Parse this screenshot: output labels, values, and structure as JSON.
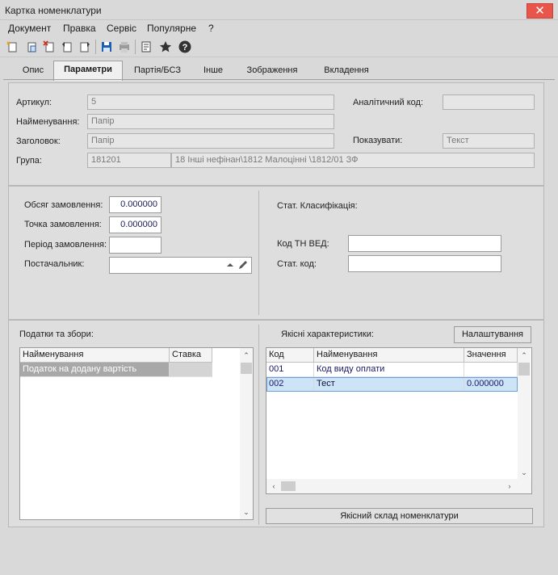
{
  "window": {
    "title": "Картка номенклатури",
    "close_glyph": "✕"
  },
  "menu": [
    "Документ",
    "Правка",
    "Сервіс",
    "Популярне",
    "?"
  ],
  "toolbar": [
    "new-icon",
    "new-copy-icon",
    "delete-icon",
    "back-icon",
    "forward-icon",
    "save-icon",
    "print-icon",
    "properties-icon",
    "favorites-star-icon",
    "help-icon"
  ],
  "tabs": [
    "Опис",
    "Параметри",
    "Партія/БСЗ",
    "Інше",
    "Зображення",
    "Вкладення"
  ],
  "active_tab": "Параметри",
  "general": {
    "article_label": "Артикул:",
    "article_value": "5",
    "name_label": "Найменування:",
    "name_value": "Папір",
    "heading_label": "Заголовок:",
    "heading_value": "Папір",
    "group_label": "Група:",
    "group_code": "181201",
    "group_path": "18 Інші нефінан\\1812 Малоцінні \\1812/01 ЗФ",
    "analytic_label": "Аналітичний код:",
    "analytic_value": "",
    "show_label": "Показувати:",
    "show_value": "Текст"
  },
  "order": {
    "volume_label": "Обсяг замовлення:",
    "volume_value": "0.000000",
    "point_label": "Точка замовлення:",
    "point_value": "0.000000",
    "period_label": "Період замовлення:",
    "period_value": "",
    "supplier_label": "Постачальник:",
    "supplier_value": ""
  },
  "stat": {
    "title": "Стат. Класифікація:",
    "tnved_label": "Код ТН ВЕД:",
    "tnved_value": "",
    "stat_code_label": "Стат. код:",
    "stat_code_value": ""
  },
  "taxes": {
    "title": "Податки та збори:",
    "columns": [
      "Найменування",
      "Ставка"
    ],
    "rows": [
      {
        "name": "Податок на додану вартість",
        "rate": ""
      }
    ]
  },
  "qualities": {
    "title": "Якісні характеристики:",
    "settings_button": "Налаштування",
    "columns": [
      "Код",
      "Найменування",
      "Значення"
    ],
    "rows": [
      {
        "code": "001",
        "name": "Код виду оплати",
        "value": ""
      },
      {
        "code": "002",
        "name": "Тест",
        "value": "0.000000"
      }
    ],
    "composition_button": "Якісний склад номенклатури"
  },
  "colors": {
    "accent_close": "#e8554b",
    "selected_row": "#cde3f7",
    "grey_row": "#a8a8a8"
  }
}
